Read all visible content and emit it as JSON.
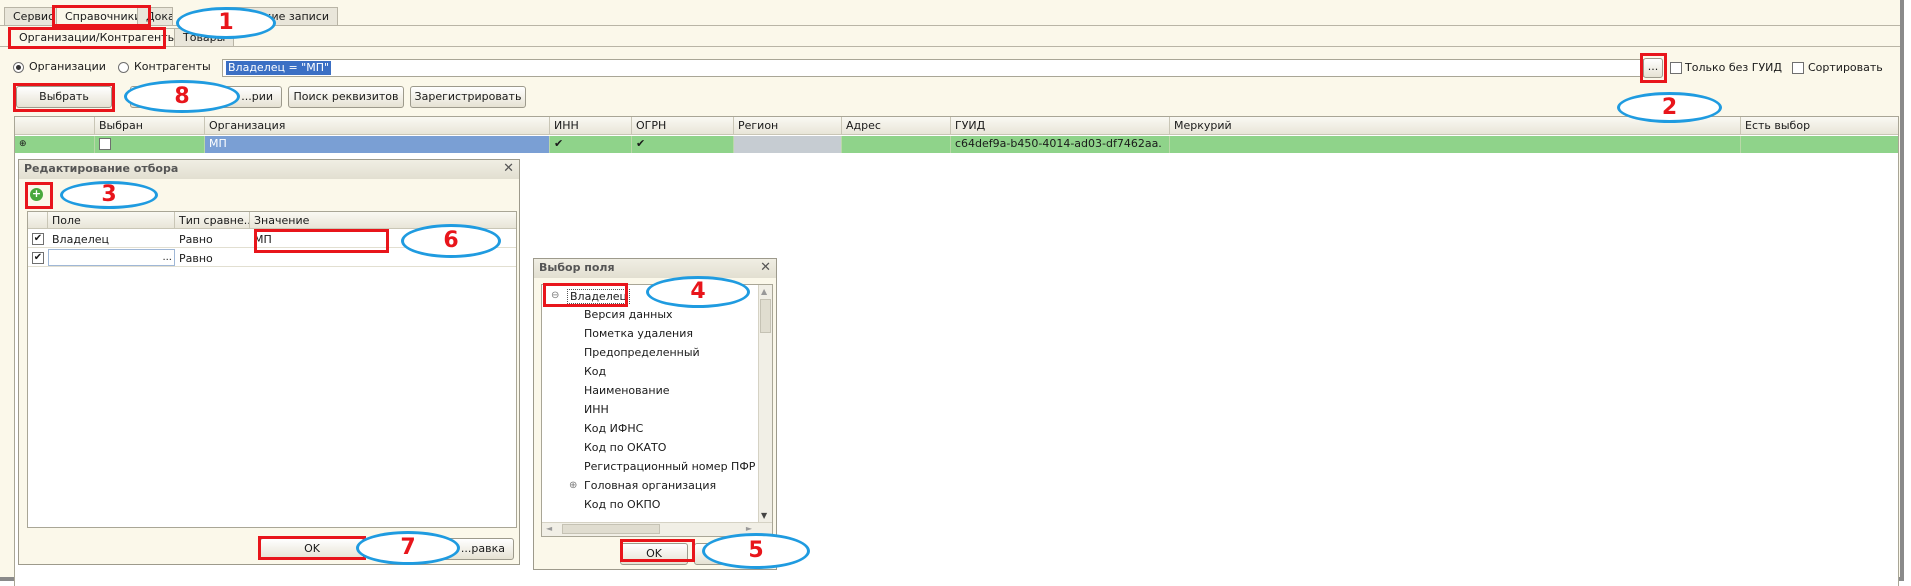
{
  "menu_tabs": [
    {
      "label": "Сервис"
    },
    {
      "label": "Справочники"
    },
    {
      "label": "Дока"
    },
    {
      "label": "...ческие записи"
    }
  ],
  "sub_tabs": [
    {
      "label": "Организации/Контрагенты"
    },
    {
      "label": "Товары"
    }
  ],
  "mode": {
    "organizations_label": "Организации",
    "counterparties_label": "Контрагенты",
    "selected": "Организации"
  },
  "filter": {
    "value": "Владелец = \"МП\"",
    "ellipsis_label": "...",
    "only_without_guid_label": "Только без ГУИД",
    "sort_label": "Сортировать"
  },
  "toolbar": {
    "select_label": "Выбрать",
    "partial_label": "...рии",
    "search_requisites_label": "Поиск реквизитов",
    "register_label": "Зарегистрировать"
  },
  "table": {
    "columns": [
      "Выбран",
      "Организация",
      "ИНН",
      "ОГРН",
      "Регион",
      "Адрес",
      "ГУИД",
      "Меркурий",
      "Есть выбор"
    ],
    "row": {
      "organization": "МП",
      "inn_mark": "✔",
      "ogrn_mark": "✔",
      "guid": "c64def9a-b450-4014-ad03-df7462aa."
    }
  },
  "edit_filter_dialog": {
    "title": "Редактирование отбора",
    "columns": [
      "Поле",
      "Тип сравне...",
      "Значение"
    ],
    "rows": [
      {
        "field": "Владелец",
        "comparison": "Равно",
        "value": "МП"
      },
      {
        "field": "",
        "comparison": "Равно",
        "value": "",
        "ellipsis": "..."
      }
    ],
    "ok_label": "OK",
    "help_label": "...равка"
  },
  "field_choice_dialog": {
    "title": "Выбор поля",
    "root": "Владелец",
    "items": [
      {
        "label": "Версия данных"
      },
      {
        "label": "Пометка удаления"
      },
      {
        "label": "Предопределенный"
      },
      {
        "label": "Код"
      },
      {
        "label": "Наименование"
      },
      {
        "label": "ИНН"
      },
      {
        "label": "Код ИФНС"
      },
      {
        "label": "Код по ОКАТО"
      },
      {
        "label": "Регистрационный номер ПФР"
      },
      {
        "label": "Головная организация"
      },
      {
        "label": "Код по ОКПО"
      }
    ],
    "ok_label": "OK"
  },
  "annotations": [
    "1",
    "2",
    "3",
    "4",
    "5",
    "6",
    "7",
    "8"
  ],
  "colors": {
    "annotation_box": "#e8151b",
    "annotation_ellipse": "#1f9be0",
    "row_green": "#8fd38a",
    "row_selected_blue": "#7a9fd4",
    "panel_bg": "#fbf8ea"
  }
}
